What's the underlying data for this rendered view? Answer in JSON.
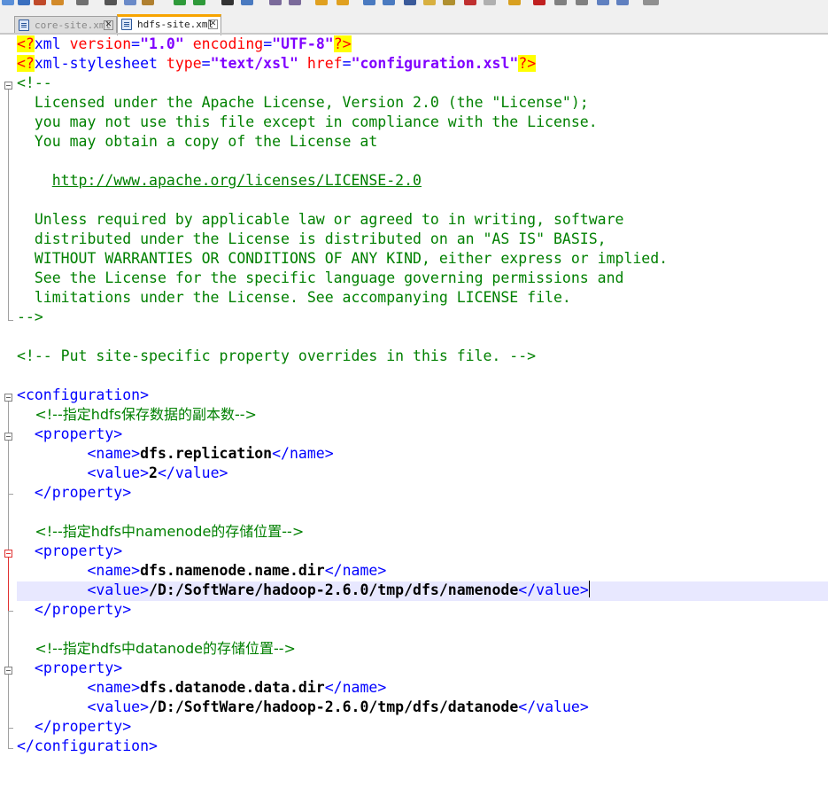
{
  "tabs": [
    {
      "name": "core-site.xml",
      "active": false
    },
    {
      "name": "hdfs-site.xml",
      "active": true
    }
  ],
  "tab_close_glyph": "✕",
  "xml": {
    "decl": {
      "version": "1.0",
      "encoding": "UTF-8"
    },
    "stylesheet": {
      "type": "text/xsl",
      "href": "configuration.xsl"
    },
    "license": {
      "open": "<!--",
      "lines": [
        "Licensed under the Apache License, Version 2.0 (the \"License\");",
        "you may not use this file except in compliance with the License.",
        "You may obtain a copy of the License at"
      ],
      "url": "http://www.apache.org/licenses/LICENSE-2.0",
      "lines2": [
        "Unless required by applicable law or agreed to in writing, software",
        "distributed under the License is distributed on an \"AS IS\" BASIS,",
        "WITHOUT WARRANTIES OR CONDITIONS OF ANY KIND, either express or implied.",
        "See the License for the specific language governing permissions and",
        "limitations under the License. See accompanying LICENSE file."
      ],
      "close": "-->"
    },
    "site_comment": "<!-- Put site-specific property overrides in this file. -->",
    "root_tag": "configuration",
    "property_tag": "property",
    "name_tag": "name",
    "value_tag": "value",
    "properties": [
      {
        "comment": "<!--指定hdfs保存数据的副本数-->",
        "name": "dfs.replication",
        "value": "2"
      },
      {
        "comment": "<!--指定hdfs中namenode的存储位置-->",
        "name": "dfs.namenode.name.dir",
        "value": "/D:/SoftWare/hadoop-2.6.0/tmp/dfs/namenode"
      },
      {
        "comment": "<!--指定hdfs中datanode的存储位置-->",
        "name": "dfs.datanode.data.dir",
        "value": "/D:/SoftWare/hadoop-2.6.0/tmp/dfs/datanode"
      }
    ]
  },
  "colors": {
    "tag": "#0000ff",
    "attribute": "#ff0000",
    "attribute_value": "#8000ff",
    "comment": "#008000",
    "pi_highlight": "#ffff00",
    "current_line": "#e8e8ff",
    "active_tab_accent": "#f7a400"
  }
}
